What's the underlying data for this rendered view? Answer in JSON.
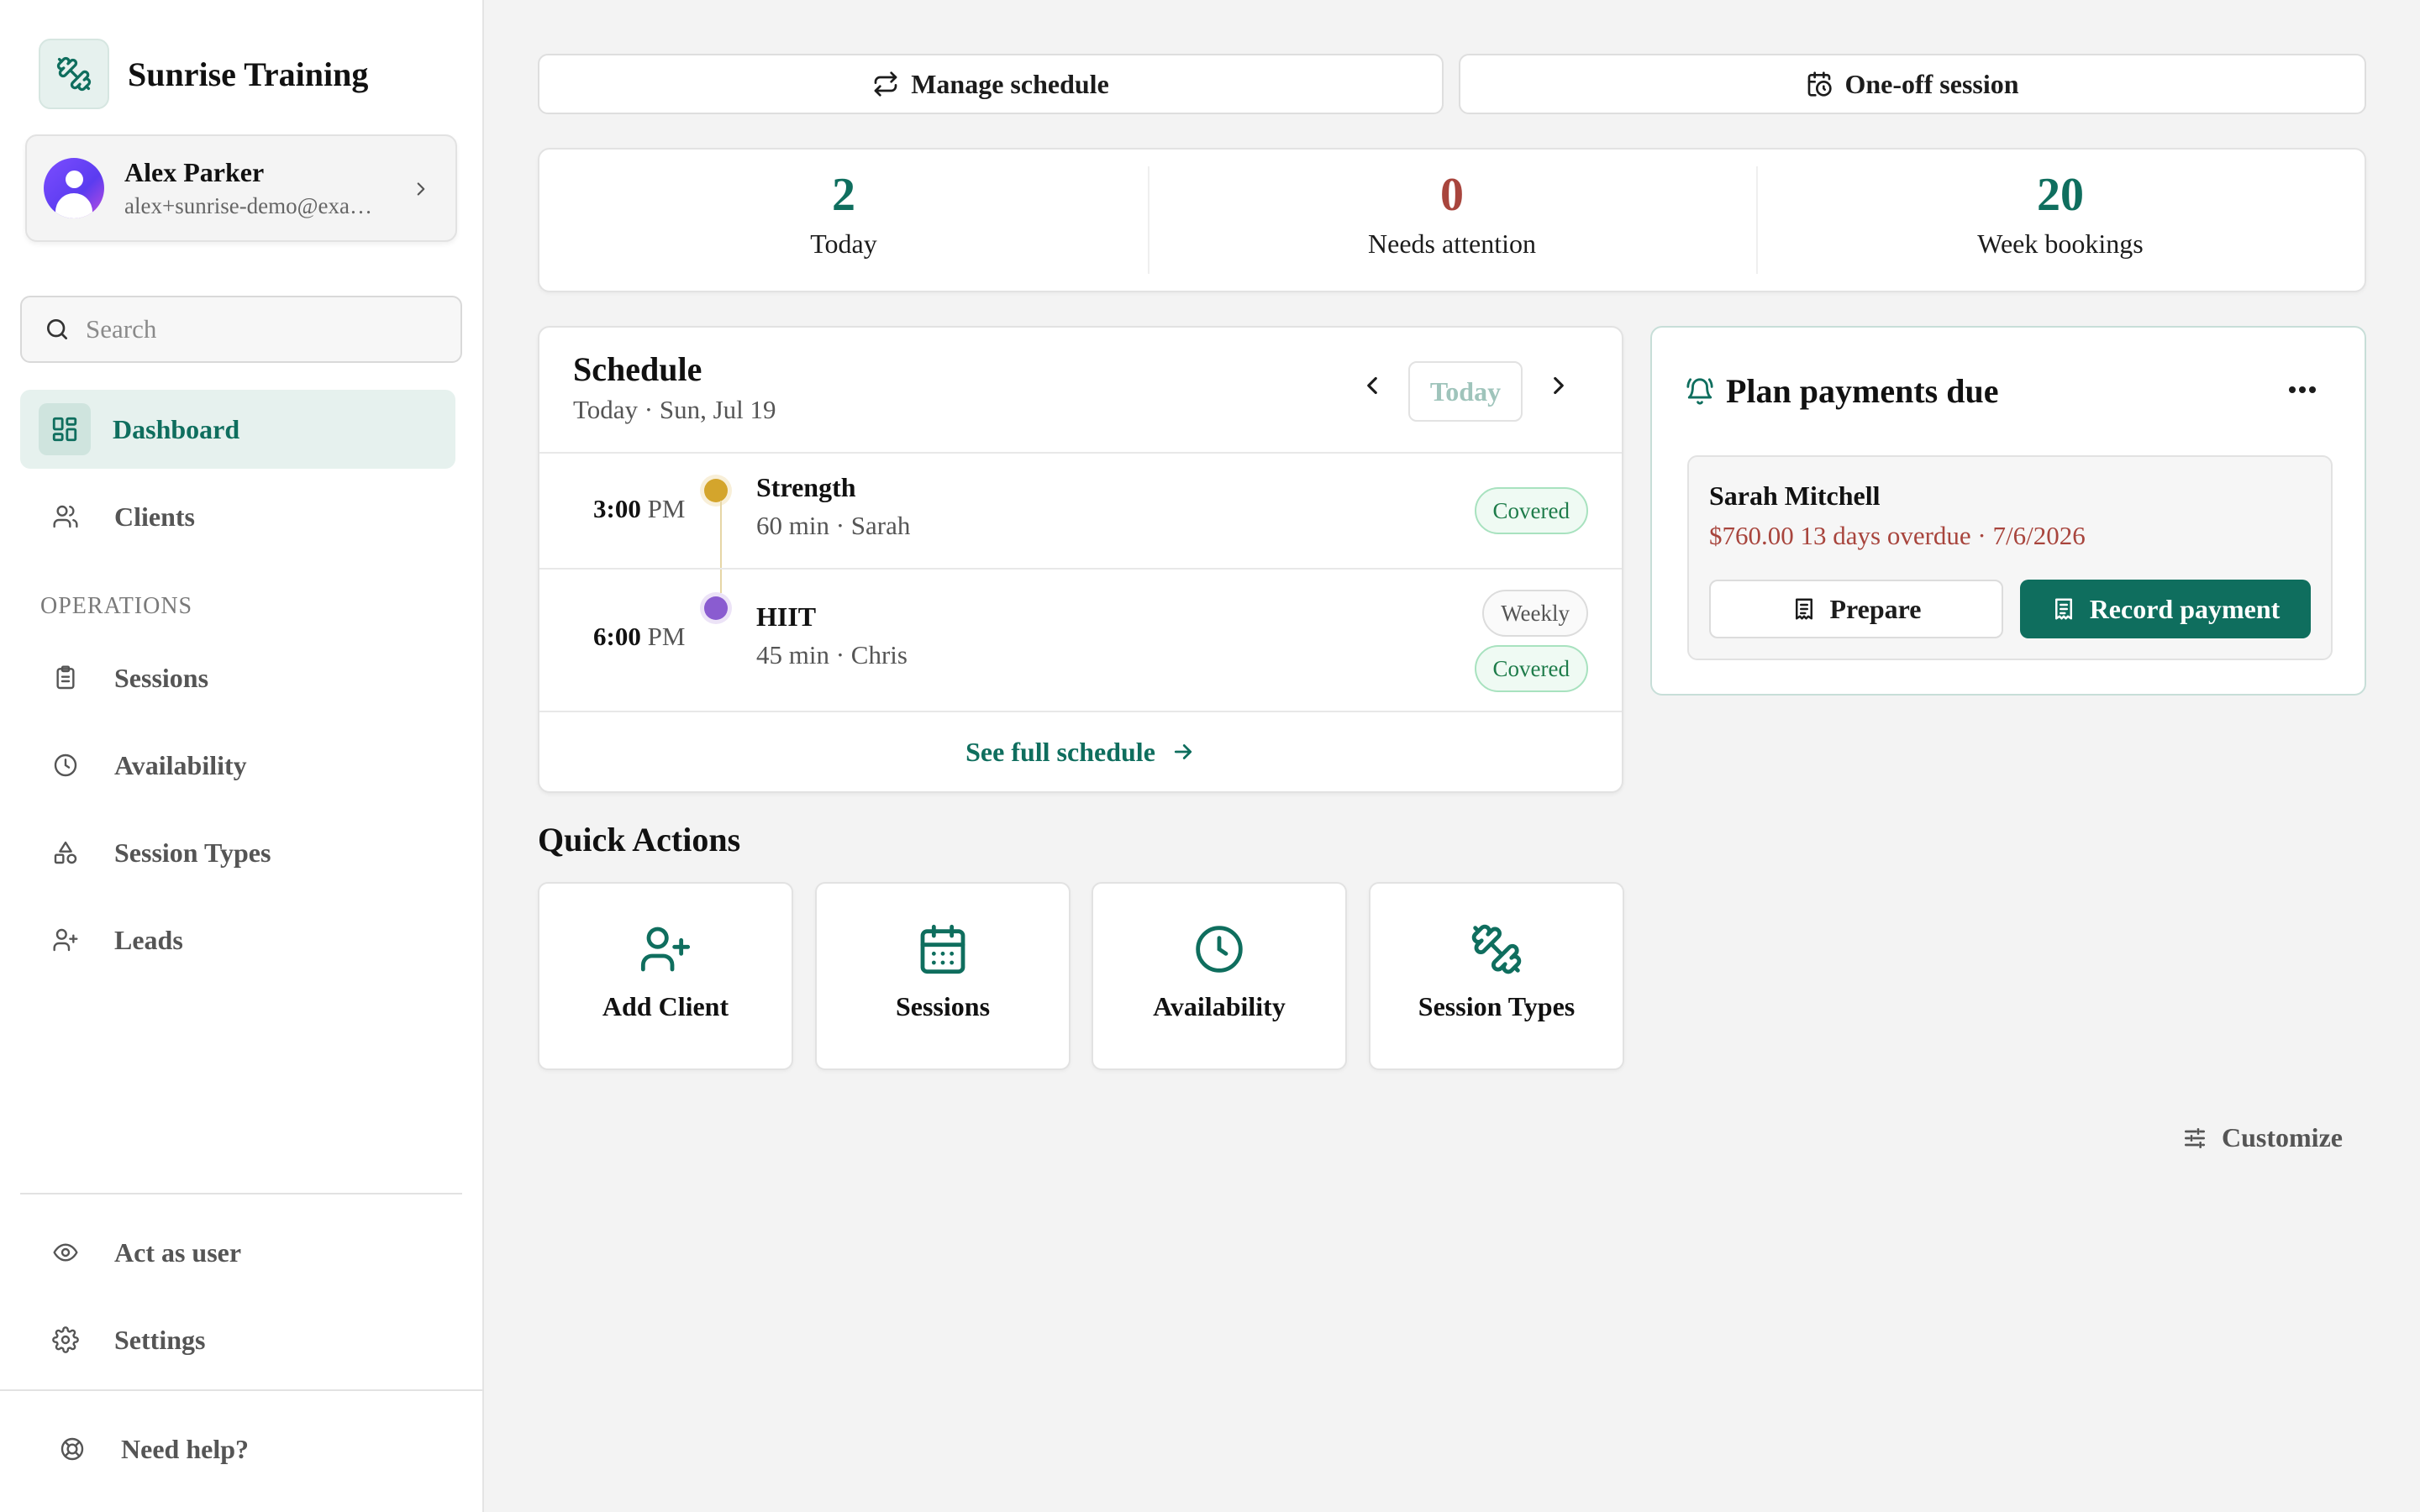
{
  "brand": {
    "name": "Sunrise Training",
    "icon": "dumbbell-icon"
  },
  "user": {
    "name": "Alex Parker",
    "email": "alex+sunrise-demo@exa…"
  },
  "search": {
    "placeholder": "Search"
  },
  "nav": {
    "main": [
      {
        "label": "Dashboard",
        "icon": "dashboard-icon",
        "active": true
      },
      {
        "label": "Clients",
        "icon": "users-icon",
        "active": false
      }
    ],
    "operations_title": "OPERATIONS",
    "operations": [
      {
        "label": "Sessions",
        "icon": "clipboard-icon"
      },
      {
        "label": "Availability",
        "icon": "clock-icon"
      },
      {
        "label": "Session Types",
        "icon": "shapes-icon"
      },
      {
        "label": "Leads",
        "icon": "user-plus-icon"
      }
    ],
    "footer": [
      {
        "label": "Act as user",
        "icon": "eye-icon"
      },
      {
        "label": "Settings",
        "icon": "gear-icon"
      }
    ],
    "help": {
      "label": "Need help?",
      "icon": "lifebuoy-icon"
    }
  },
  "toolbar": {
    "manage_schedule": "Manage schedule",
    "one_off_session": "One-off session"
  },
  "stats": [
    {
      "value": "2",
      "label": "Today",
      "color": "#0f6e5e"
    },
    {
      "value": "0",
      "label": "Needs attention",
      "color": "#a8453d"
    },
    {
      "value": "20",
      "label": "Week bookings",
      "color": "#0f6e5e"
    }
  ],
  "schedule": {
    "title": "Schedule",
    "subtitle": "Today · Sun, Jul 19",
    "today_button": "Today",
    "rows": [
      {
        "time": "3:00",
        "ampm": "PM",
        "name": "Strength",
        "meta": "60 min · Sarah",
        "dot_color": "#d4a52c",
        "badges": [
          "Covered"
        ]
      },
      {
        "time": "6:00",
        "ampm": "PM",
        "name": "HIIT",
        "meta": "45 min · Chris",
        "dot_color": "#8a5cd0",
        "badges": [
          "Weekly",
          "Covered"
        ]
      }
    ],
    "see_full": "See full schedule"
  },
  "payments": {
    "title": "Plan payments due",
    "client": "Sarah Mitchell",
    "detail": "$760.00 13 days overdue · 7/6/2026",
    "prepare": "Prepare",
    "record": "Record payment"
  },
  "quick_actions": {
    "title": "Quick Actions",
    "items": [
      {
        "label": "Add Client",
        "icon": "user-plus-icon"
      },
      {
        "label": "Sessions",
        "icon": "calendar-icon"
      },
      {
        "label": "Availability",
        "icon": "clock-icon"
      },
      {
        "label": "Session Types",
        "icon": "dumbbell-icon"
      }
    ]
  },
  "customize": {
    "label": "Customize"
  },
  "colors": {
    "accent": "#0f6e5e",
    "danger": "#a8453d",
    "sidebar_active_bg": "#e6f1ee"
  }
}
